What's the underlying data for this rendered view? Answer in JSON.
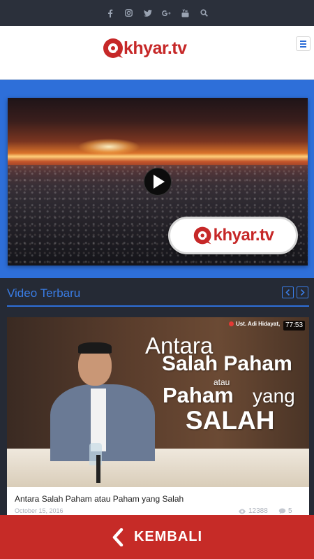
{
  "topbar": {
    "icons": [
      "facebook-icon",
      "instagram-icon",
      "twitter-icon",
      "google-plus-icon",
      "youtube-icon",
      "search-icon"
    ]
  },
  "header": {
    "logo_text": "khyar.tv",
    "menu_icon": "hamburger-icon",
    "brand_color": "#c62828"
  },
  "hero": {
    "background_color": "#2e6fd9",
    "badge_text": "khyar.tv"
  },
  "section": {
    "title": "Video Terbaru",
    "prev_icon": "chevron-left-icon",
    "next_icon": "chevron-right-icon"
  },
  "video_card": {
    "thumbnail_text": {
      "line1": "Antara",
      "line2": "Salah Paham",
      "line3": "atau",
      "line4": "Paham",
      "line5": "yang",
      "line6": "SALAH"
    },
    "speaker": "Ust. Adi Hidayat,",
    "duration": "77:53",
    "title": "Antara Salah Paham atau Paham yang Salah",
    "date": "October 15, 2016",
    "views": "12388",
    "comments": "5"
  },
  "footer": {
    "back_label": "KEMBALI",
    "back_icon": "chevron-left-icon",
    "background_color": "#c62b27"
  }
}
